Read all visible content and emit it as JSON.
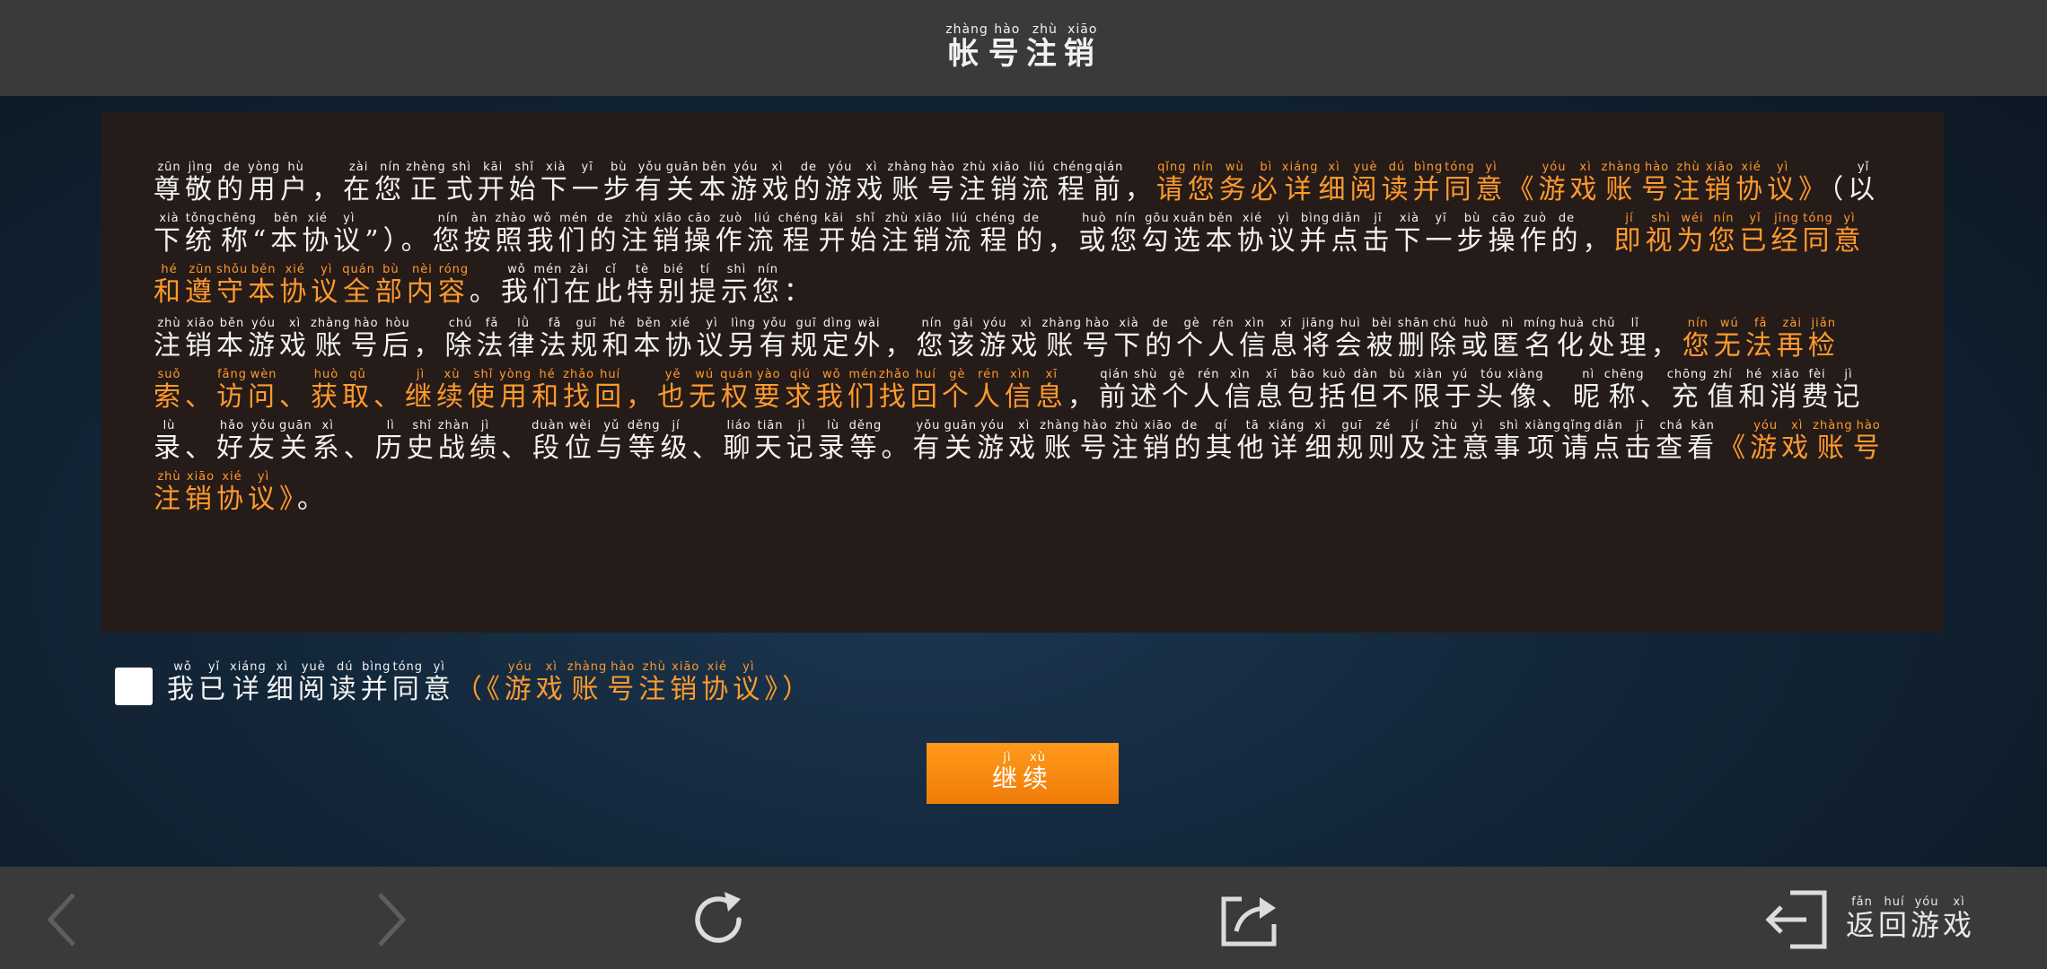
{
  "header": {
    "title": [
      {
        "c": "帐",
        "p": "zhàng"
      },
      {
        "c": "号",
        "p": "hào"
      },
      {
        "c": "注",
        "p": "zhù"
      },
      {
        "c": "销",
        "p": "xiāo"
      }
    ]
  },
  "content": {
    "paragraphs": [
      [
        {
          "t": "尊敬的用户，在您正式开始下一步有关本游戏的游戏账号注销流程前，",
          "h": false
        },
        {
          "t": "请您务必详细阅读并同意《游戏账号注销协议》",
          "h": true
        },
        {
          "t": "（以下统称“本协议”）。您按照我们的注销操作流程开始注销流程的，或您勾选本协议并点击下一步操作的，",
          "h": false
        },
        {
          "t": "即视为您已经同意和遵守本协议全部内容",
          "h": true
        },
        {
          "t": "。我们在此特别提示您：",
          "h": false
        }
      ],
      [
        {
          "t": "注销本游戏账号后，除法律法规和本协议另有规定外，您该游戏账号下的个人信息将会被删除或匿名化处理，",
          "h": false
        },
        {
          "t": "您无法再检索、访问、获取、继续使用和找回，也无权要求我们找回个人信息",
          "h": true
        },
        {
          "t": "，前述个人信息包括但不限于头像、昵称、充值和消费记录、好友关系、历史战绩、段位与等级、聊天记录等。有关游戏账号注销的其他详细规则及注意事项请点击查看",
          "h": false
        },
        {
          "t": "《游戏账号注销协议》",
          "h": true
        },
        {
          "t": "。",
          "h": false
        }
      ]
    ]
  },
  "agreement": {
    "checked": false,
    "segments": [
      {
        "t": "我已详细阅读并同意",
        "h": false
      },
      {
        "t": "（",
        "h": true
      },
      {
        "t": "《游戏账号注销协议》",
        "h": true
      },
      {
        "t": "）",
        "h": true
      }
    ]
  },
  "continue_button": [
    {
      "c": "继",
      "p": "jì"
    },
    {
      "c": "续",
      "p": "xù"
    }
  ],
  "bottom_bar": {
    "back_to_game": [
      {
        "c": "返",
        "p": "fǎn"
      },
      {
        "c": "回",
        "p": "huí"
      },
      {
        "c": "游",
        "p": "yóu"
      },
      {
        "c": "戏",
        "p": "xì"
      }
    ]
  },
  "pinyin": {
    "尊": "zūn",
    "敬": "jìng",
    "的": "de",
    "用": "yòng",
    "户": "hù",
    "在": "zài",
    "您": "nín",
    "正": "zhèng",
    "式": "shì",
    "开": "kāi",
    "始": "shǐ",
    "下": "xià",
    "一": "yī",
    "步": "bù",
    "有": "yǒu",
    "关": "guān",
    "本": "běn",
    "游": "yóu",
    "戏": "xì",
    "账": "zhàng",
    "号": "hào",
    "注": "zhù",
    "销": "xiāo",
    "流": "liú",
    "程": "chéng",
    "前": "qián",
    "请": "qǐng",
    "务": "wù",
    "必": "bì",
    "详": "xiáng",
    "细": "xì",
    "阅": "yuè",
    "读": "dú",
    "并": "bìng",
    "同": "tóng",
    "意": "yì",
    "协": "xié",
    "议": "yì",
    "以": "yǐ",
    "统": "tǒng",
    "称": "chēng",
    "按": "àn",
    "照": "zhào",
    "我": "wǒ",
    "们": "mén",
    "操": "cāo",
    "作": "zuò",
    "或": "huò",
    "勾": "gōu",
    "选": "xuǎn",
    "点": "diǎn",
    "击": "jī",
    "即": "jí",
    "视": "shì",
    "为": "wéi",
    "已": "yǐ",
    "经": "jīng",
    "和": "hé",
    "遵": "zūn",
    "守": "shǒu",
    "全": "quán",
    "部": "bù",
    "内": "nèi",
    "容": "róng",
    "此": "cǐ",
    "特": "tè",
    "别": "bié",
    "提": "tí",
    "示": "shì",
    "后": "hòu",
    "除": "chú",
    "法": "fǎ",
    "律": "lǜ",
    "规": "guī",
    "另": "lìng",
    "定": "dìng",
    "外": "wài",
    "该": "gāi",
    "个": "gè",
    "人": "rén",
    "信": "xìn",
    "息": "xī",
    "将": "jiāng",
    "会": "huì",
    "被": "bèi",
    "删": "shān",
    "匿": "nì",
    "名": "míng",
    "化": "huà",
    "处": "chǔ",
    "理": "lǐ",
    "无": "wú",
    "再": "zài",
    "检": "jiǎn",
    "索": "suǒ",
    "访": "fǎng",
    "问": "wèn",
    "获": "huò",
    "取": "qǔ",
    "继": "jì",
    "续": "xù",
    "使": "shǐ",
    "找": "zhǎo",
    "回": "huí",
    "也": "yě",
    "权": "quán",
    "要": "yào",
    "求": "qiú",
    "述": "shù",
    "包": "bāo",
    "括": "kuò",
    "但": "dàn",
    "不": "bù",
    "限": "xiàn",
    "于": "yú",
    "头": "tóu",
    "像": "xiàng",
    "昵": "nì",
    "充": "chōng",
    "值": "zhí",
    "消": "xiāo",
    "费": "fèi",
    "记": "jì",
    "录": "lù",
    "好": "hǎo",
    "友": "yǒu",
    "系": "xì",
    "历": "lì",
    "史": "shǐ",
    "战": "zhàn",
    "绩": "jì",
    "段": "duàn",
    "位": "wèi",
    "与": "yǔ",
    "等": "děng",
    "级": "jí",
    "聊": "liáo",
    "天": "tiān",
    "其": "qí",
    "他": "tā",
    "则": "zé",
    "及": "jí",
    "事": "shì",
    "项": "xiàng",
    "查": "chá",
    "看": "kàn"
  },
  "colors": {
    "highlight": "#ff9a2e",
    "text": "#f2f2f2",
    "panel": "#251b18",
    "bar": "#3a3a3a",
    "button": "#f5880f"
  },
  "icons": {
    "prev": "chevron-left-icon",
    "next": "chevron-right-icon",
    "refresh": "refresh-icon",
    "share": "share-icon",
    "exit": "exit-icon"
  }
}
